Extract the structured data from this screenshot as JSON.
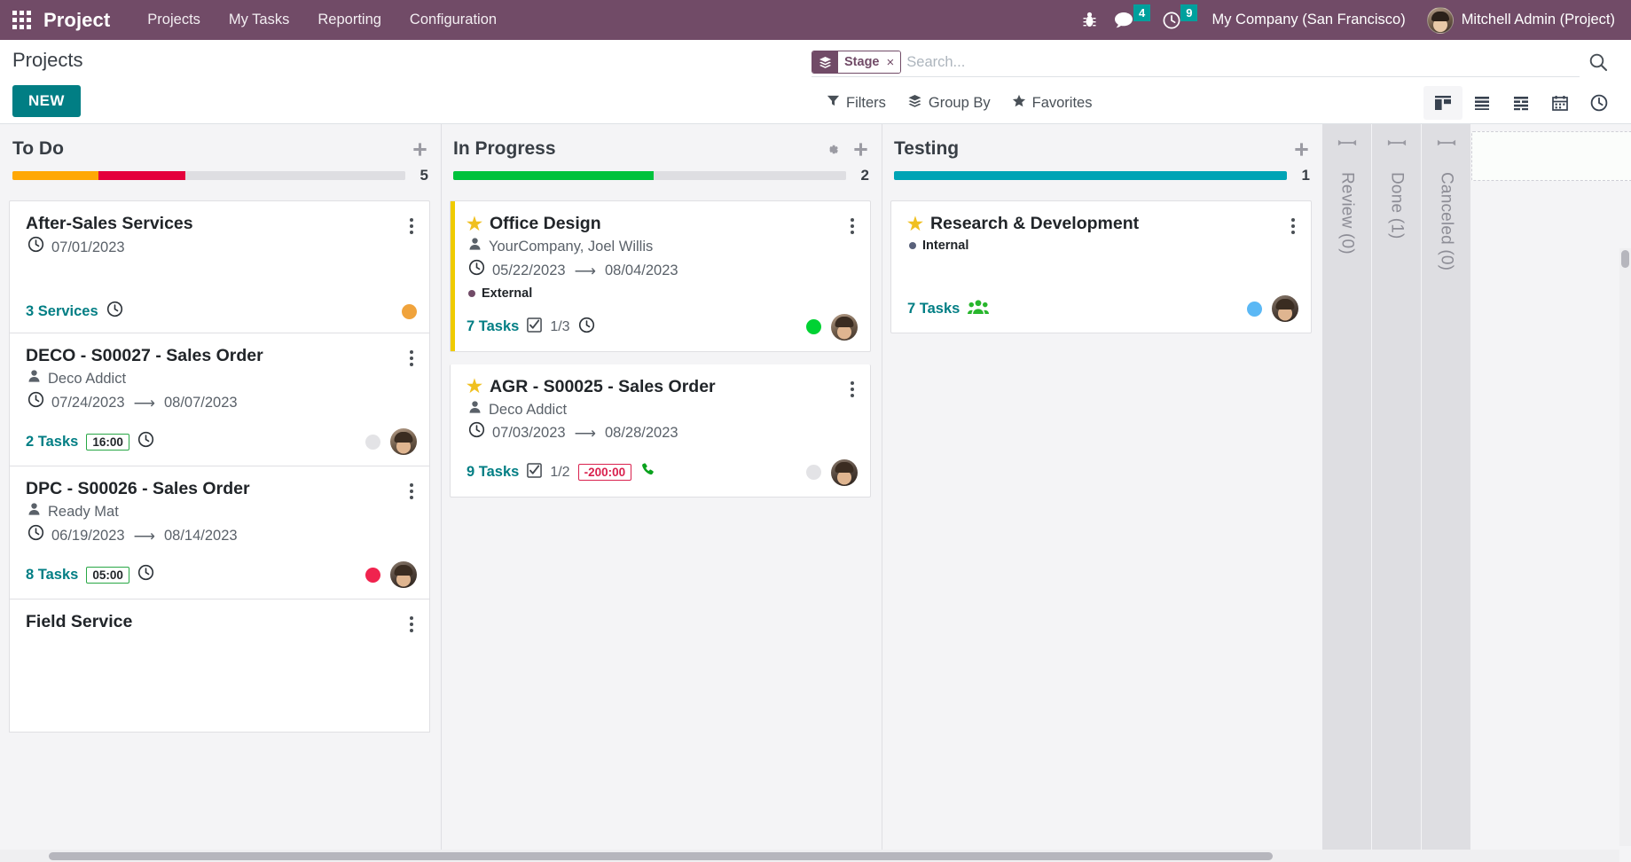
{
  "navbar": {
    "apps_icon": "apps-grid-icon",
    "brand": "Project",
    "menu": [
      {
        "label": "Projects"
      },
      {
        "label": "My Tasks"
      },
      {
        "label": "Reporting"
      },
      {
        "label": "Configuration"
      }
    ],
    "bug_icon": "bug-icon",
    "messages": {
      "icon": "chat-bubble-icon",
      "count": "4"
    },
    "activities": {
      "icon": "clock-icon",
      "count": "9"
    },
    "company": "My Company (San Francisco)",
    "user": "Mitchell Admin (Project)"
  },
  "control_panel": {
    "title": "Projects",
    "new_button": "NEW",
    "search": {
      "facet_icon": "layers-icon",
      "facet_label": "Stage",
      "facet_remove": "×",
      "placeholder": "Search...",
      "value": "",
      "magnifier_icon": "search-icon"
    },
    "filters": [
      {
        "label": "Filters",
        "icon": "funnel-icon"
      },
      {
        "label": "Group By",
        "icon": "layers-icon"
      },
      {
        "label": "Favorites",
        "icon": "star-icon"
      }
    ],
    "views": [
      {
        "name": "kanban",
        "icon": "kanban-icon",
        "active": true
      },
      {
        "name": "list",
        "icon": "list-icon",
        "active": false
      },
      {
        "name": "pivot",
        "icon": "pivot-icon",
        "active": false
      },
      {
        "name": "calendar",
        "icon": "calendar-icon",
        "active": false
      },
      {
        "name": "activity",
        "icon": "clock-icon",
        "active": false
      }
    ]
  },
  "kanban": {
    "columns": [
      {
        "title": "To Do",
        "count": "5",
        "has_gear": false,
        "progress": [
          {
            "color": "#FFA806",
            "pct": 22
          },
          {
            "color": "#E4003C",
            "pct": 22
          },
          {
            "color": "#DEDEE2",
            "pct": 56
          }
        ],
        "cards": [
          {
            "title": "After-Sales Services",
            "starred": false,
            "accent": "",
            "customer": "",
            "date_single": "07/01/2023",
            "date_start": "",
            "date_end": "",
            "tag": "",
            "tag_color": "",
            "tasks": "3 Services",
            "subtasks": "",
            "time_badge": "",
            "time_badge_state": "",
            "show_clock": true,
            "show_phone": false,
            "show_group": false,
            "status_dot": "#F0A33C",
            "show_avatar": false,
            "avatar_style": ""
          },
          {
            "title": "DECO - S00027 - Sales Order",
            "starred": false,
            "accent": "",
            "customer": "Deco Addict",
            "date_single": "",
            "date_start": "07/24/2023",
            "date_end": "08/07/2023",
            "tag": "",
            "tag_color": "",
            "tasks": "2 Tasks",
            "subtasks": "",
            "time_badge": "16:00",
            "time_badge_state": "positive",
            "show_clock": true,
            "show_phone": false,
            "show_group": false,
            "status_dot": "#E3E3E6",
            "show_avatar": true,
            "avatar_style": "light"
          },
          {
            "title": "DPC - S00026 - Sales Order",
            "starred": false,
            "accent": "",
            "customer": "Ready Mat",
            "date_single": "",
            "date_start": "06/19/2023",
            "date_end": "08/14/2023",
            "tag": "",
            "tag_color": "",
            "tasks": "8 Tasks",
            "subtasks": "",
            "time_badge": "05:00",
            "time_badge_state": "positive",
            "show_clock": true,
            "show_phone": false,
            "show_group": false,
            "status_dot": "#F0234E",
            "show_avatar": true,
            "avatar_style": "dark"
          },
          {
            "title": "Field Service",
            "starred": false,
            "accent": "",
            "customer": "",
            "date_single": "",
            "date_start": "",
            "date_end": "",
            "tag": "",
            "tag_color": "",
            "tasks": "",
            "subtasks": "",
            "time_badge": "",
            "time_badge_state": "",
            "show_clock": false,
            "show_phone": false,
            "show_group": false,
            "status_dot": "",
            "show_avatar": false,
            "avatar_style": ""
          }
        ]
      },
      {
        "title": "In Progress",
        "count": "2",
        "has_gear": true,
        "progress": [
          {
            "color": "#00C23C",
            "pct": 51
          },
          {
            "color": "#DEDEE2",
            "pct": 49
          }
        ],
        "cards": [
          {
            "title": "Office Design",
            "starred": true,
            "accent": "#EFCB00",
            "customer": "YourCompany, Joel Willis",
            "date_single": "",
            "date_start": "05/22/2023",
            "date_end": "08/04/2023",
            "tag": "External",
            "tag_color": "#714B67",
            "tasks": "7 Tasks",
            "subtasks": "1/3",
            "time_badge": "",
            "time_badge_state": "",
            "show_clock": true,
            "show_phone": false,
            "show_group": false,
            "status_dot": "#00D233",
            "show_avatar": true,
            "avatar_style": "light"
          },
          {
            "title": "AGR - S00025 - Sales Order",
            "starred": true,
            "accent": "",
            "customer": "Deco Addict",
            "date_single": "",
            "date_start": "07/03/2023",
            "date_end": "08/28/2023",
            "tag": "",
            "tag_color": "",
            "tasks": "9 Tasks",
            "subtasks": "1/2",
            "time_badge": "-200:00",
            "time_badge_state": "negative",
            "show_clock": false,
            "show_phone": true,
            "show_group": false,
            "status_dot": "#E3E3E6",
            "show_avatar": true,
            "avatar_style": "dark"
          }
        ]
      },
      {
        "title": "Testing",
        "count": "1",
        "has_gear": false,
        "progress": [
          {
            "color": "#00A4B5",
            "pct": 100
          }
        ],
        "cards": [
          {
            "title": "Research & Development",
            "starred": true,
            "accent": "",
            "customer": "",
            "date_single": "",
            "date_start": "",
            "date_end": "",
            "tag": "Internal",
            "tag_color": "#59617A",
            "tasks": "7 Tasks",
            "subtasks": "",
            "time_badge": "",
            "time_badge_state": "",
            "show_clock": false,
            "show_phone": false,
            "show_group": true,
            "status_dot": "#5BB8F5",
            "show_avatar": true,
            "avatar_style": "dark"
          }
        ]
      }
    ],
    "folded_columns": [
      {
        "label": "Review (0)",
        "icon": "expand-horizontal-icon"
      },
      {
        "label": "Done (1)",
        "icon": "expand-horizontal-icon"
      },
      {
        "label": "Canceled (0)",
        "icon": "expand-horizontal-icon"
      }
    ]
  }
}
